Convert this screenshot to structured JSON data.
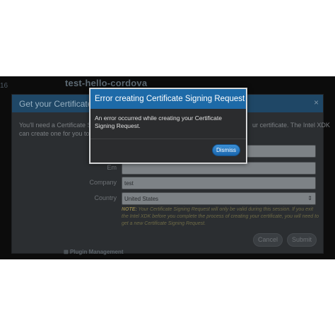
{
  "background": {
    "app_title": "test-hello-cordova",
    "left_stub": "16",
    "dialog": {
      "title": "Get your Certificate Signing Request",
      "close_glyph": "×",
      "desc_line1": "You'll need a Certificate Signing",
      "desc_line2": "can create one for you to dow",
      "desc_right": "ur certificate. The Intel XDK",
      "fields": [
        {
          "label": "O",
          "value": ""
        },
        {
          "label": "Em",
          "value": ""
        },
        {
          "label": "Company",
          "value": "test"
        },
        {
          "label": "Country",
          "value": "United States"
        }
      ],
      "note_label": "NOTE:",
      "note_text": " Your Certificate Signing Request will only be valid during this session. If you exit the Intel XDK before you complete the process of creating your certificate, you will need to get a new Certificate Signing Request.",
      "cancel_label": "Cancel",
      "submit_label": "Submit"
    },
    "bottom_item": "Plugin Management"
  },
  "modal": {
    "title": "Error creating Certificate Signing Request",
    "message": "An error occurred while creating your Certificate Signing Request.",
    "dismiss_label": "Dismiss"
  },
  "colors": {
    "modal_header": "#1d6aa8",
    "dismiss_button": "#1a66ad",
    "overlay": "#0c0c0c"
  }
}
